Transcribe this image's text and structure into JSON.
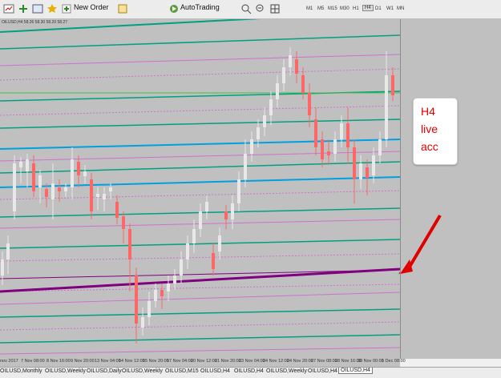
{
  "toolbar": {
    "new_order_label": "New Order",
    "autotrading_label": "AutoTrading",
    "timeframes": [
      "M1",
      "M5",
      "M15",
      "M30",
      "H1",
      "H4",
      "D1",
      "W1",
      "MN"
    ],
    "active_timeframe": "H4"
  },
  "chart": {
    "title": "OILUSD,H4  58.26 58.30 58.20 58.27",
    "x_labels": [
      "nov 2017",
      "7 Nov 08:00",
      "8 Nov 16:00",
      "9 Nov 20:00",
      "13 Nov 04:00",
      "14 Nov 12:00",
      "15 Nov 20:00",
      "17 Nov 04:00",
      "20 Nov 12:00",
      "21 Nov 20:00",
      "23 Nov 04:00",
      "24 Nov 12:00",
      "24 Nov 20:00",
      "27 Nov 08:00",
      "28 Nov 16:00",
      "30 Nov 00:00",
      "1 Dec 08:00"
    ],
    "colors": {
      "bull": "#e8e8e8",
      "bear": "#ff6666",
      "teal": "#00a080",
      "pink": "#d070d0",
      "blue": "#00a0e0",
      "purple": "#800080",
      "green": "#40c040"
    }
  },
  "note": {
    "lines": [
      "H4",
      "live",
      "acc"
    ]
  },
  "tabs": [
    "OILUSD,Monthly",
    "OILUSD,Weekly",
    "OILUSD,Daily",
    "OILUSD,Weekly",
    "OILUSD,M15",
    "OILUSD,H4",
    "OILUSD,H4",
    "OILUSD,Weekly",
    "OILUSD,H4",
    "OILUSD,H4"
  ],
  "active_tab_index": 9
}
